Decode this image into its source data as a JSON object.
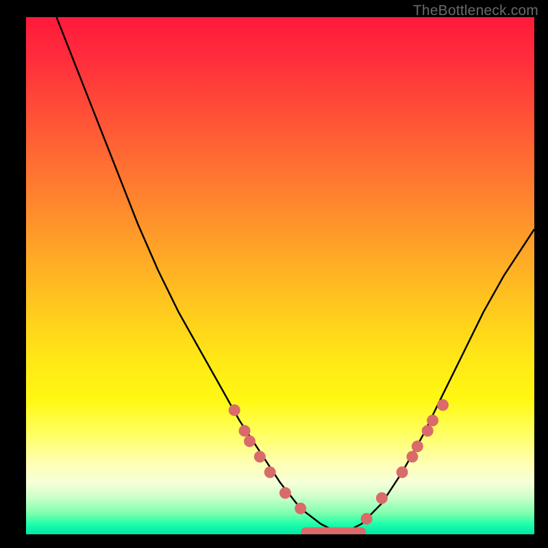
{
  "watermark": "TheBottleneck.com",
  "chart_data": {
    "type": "line",
    "title": "",
    "xlabel": "",
    "ylabel": "",
    "xlim": [
      0,
      100
    ],
    "ylim": [
      0,
      100
    ],
    "grid": false,
    "legend": false,
    "series": [
      {
        "name": "bottleneck-curve",
        "x": [
          6,
          10,
          14,
          18,
          22,
          26,
          30,
          34,
          38,
          42,
          46,
          50,
          54,
          58,
          62,
          66,
          70,
          74,
          78,
          82,
          86,
          90,
          94,
          98,
          100
        ],
        "y": [
          100,
          90,
          80,
          70,
          60,
          51,
          43,
          36,
          29,
          22,
          16,
          10,
          5,
          2,
          0,
          2,
          6,
          12,
          19,
          27,
          35,
          43,
          50,
          56,
          59
        ]
      }
    ],
    "markers": {
      "name": "highlight-points",
      "color": "#d96b6b",
      "points": [
        {
          "x": 41,
          "y": 24
        },
        {
          "x": 43,
          "y": 20
        },
        {
          "x": 44,
          "y": 18
        },
        {
          "x": 46,
          "y": 15
        },
        {
          "x": 48,
          "y": 12
        },
        {
          "x": 51,
          "y": 8
        },
        {
          "x": 54,
          "y": 5
        },
        {
          "x": 67,
          "y": 3
        },
        {
          "x": 70,
          "y": 7
        },
        {
          "x": 74,
          "y": 12
        },
        {
          "x": 76,
          "y": 15
        },
        {
          "x": 77,
          "y": 17
        },
        {
          "x": 79,
          "y": 20
        },
        {
          "x": 80,
          "y": 22
        },
        {
          "x": 82,
          "y": 25
        }
      ],
      "flat_segment": {
        "x0": 55,
        "x1": 66,
        "y": 0.5
      }
    },
    "background_gradient": {
      "top": "#ff1a3a",
      "mid_upper": "#ffa128",
      "mid": "#ffe716",
      "mid_lower": "#ffffb0",
      "bottom": "#00e6a8"
    }
  }
}
